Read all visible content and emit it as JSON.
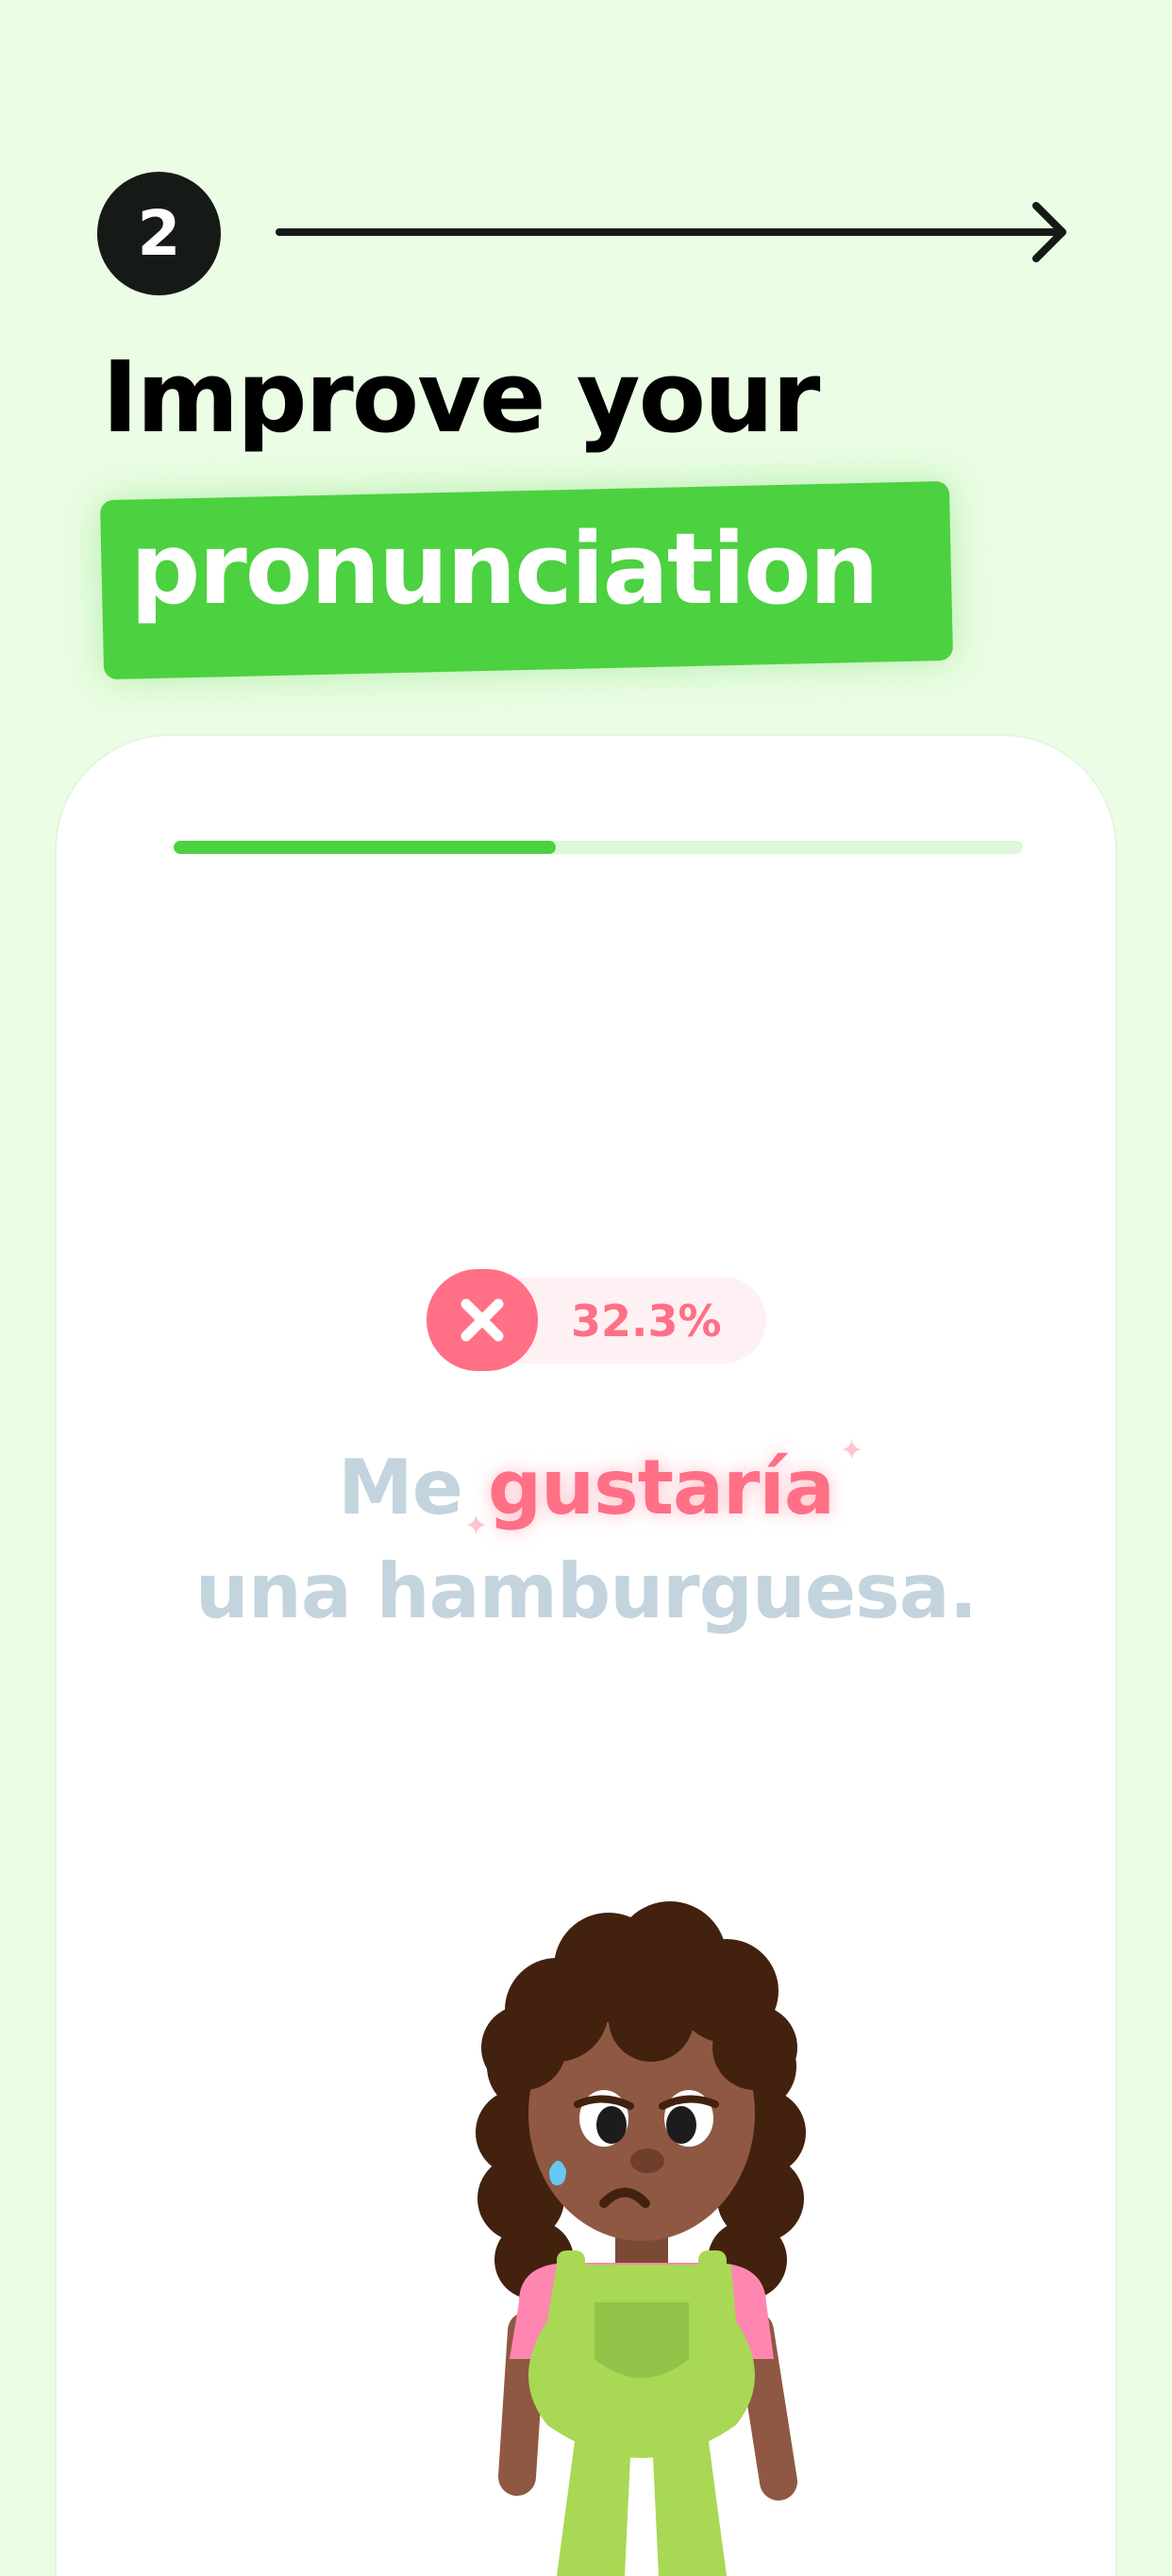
{
  "step": {
    "number": "2"
  },
  "headline": {
    "line1": "Improve your",
    "line2": "pronunciation"
  },
  "exercise": {
    "progress": 0.45,
    "score": {
      "icon": "close-icon",
      "value": "32.3%"
    },
    "sentence": {
      "word1": "Me",
      "highlighted_word": "gustaría",
      "line2": "una hamburguesa."
    }
  },
  "colors": {
    "background": "#ebfde4",
    "brand_green": "#4cd140",
    "error_pink": "#ff6f86",
    "muted_text": "#c3d4de"
  }
}
